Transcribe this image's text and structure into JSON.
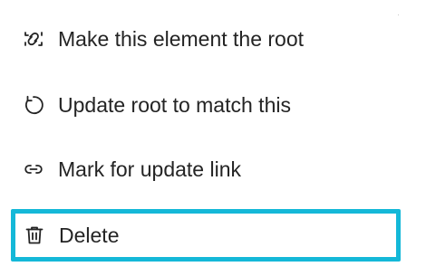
{
  "menu": {
    "items": [
      {
        "label": "Make this element the root",
        "icon": "link-root-icon"
      },
      {
        "label": "Update root to match this",
        "icon": "undo-arrow-icon"
      },
      {
        "label": "Mark for update link",
        "icon": "link-icon"
      },
      {
        "label": "Delete",
        "icon": "trash-icon"
      }
    ],
    "focus_color": "#14b8d8"
  }
}
